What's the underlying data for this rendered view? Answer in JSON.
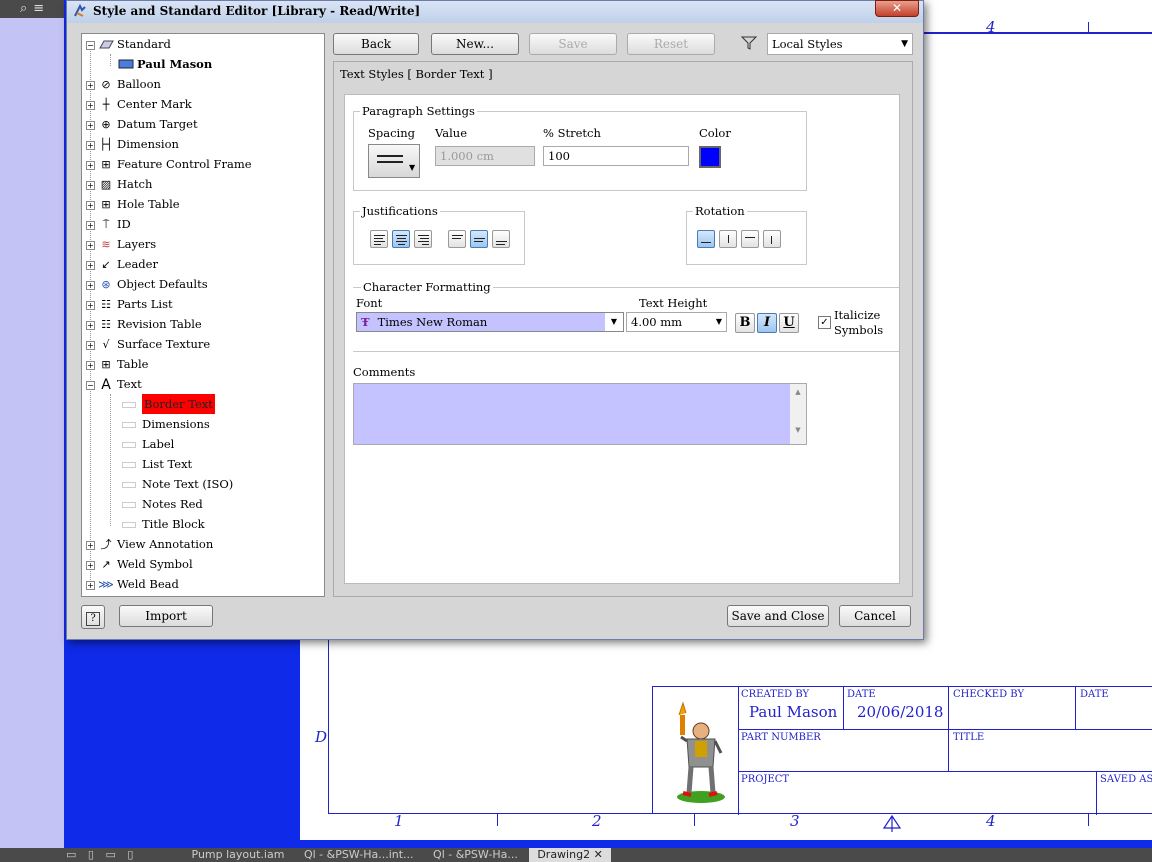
{
  "topbar": {
    "icons": [
      "search-icon",
      "menu-icon"
    ]
  },
  "drawing": {
    "top_number": "4",
    "zone_numbers": [
      "1",
      "2",
      "3",
      "4"
    ],
    "zone_letter": "D",
    "title_block": {
      "created_by_label": "CREATED BY",
      "created_by_value": "Paul Mason",
      "date_label": "DATE",
      "date_value": "20/06/2018",
      "checked_by_label": "CHECKED BY",
      "date2_label": "DATE",
      "part_number_label": "PART NUMBER",
      "title_label": "TITLE",
      "project_label": "PROJECT",
      "saved_as_label": "SAVED AS"
    }
  },
  "bottombar": {
    "tabs": [
      "Pump layout.iam",
      "Ql - &PSW-Ha...int...",
      "Ql - &PSW-Ha...",
      "Drawing2"
    ],
    "active_tab": "Drawing2",
    "close": "✕"
  },
  "dialog": {
    "title": "Style and Standard Editor [Library - Read/Write]",
    "close": "✕",
    "toolbar": {
      "back": "Back",
      "new": "New...",
      "save": "Save",
      "reset": "Reset",
      "filter_value": "Local Styles"
    },
    "tree": {
      "items": [
        {
          "label": "Standard",
          "icon": "standard-icon",
          "level": 0,
          "expanded": true
        },
        {
          "label": "Paul Mason",
          "icon": "style-icon",
          "level": 1,
          "bold": true
        },
        {
          "label": "Balloon",
          "icon": "balloon-icon",
          "level": 0
        },
        {
          "label": "Center Mark",
          "icon": "center-mark-icon",
          "level": 0
        },
        {
          "label": "Datum Target",
          "icon": "datum-target-icon",
          "level": 0
        },
        {
          "label": "Dimension",
          "icon": "dimension-icon",
          "level": 0
        },
        {
          "label": "Feature Control Frame",
          "icon": "feature-control-frame-icon",
          "level": 0
        },
        {
          "label": "Hatch",
          "icon": "hatch-icon",
          "level": 0
        },
        {
          "label": "Hole Table",
          "icon": "hole-table-icon",
          "level": 0
        },
        {
          "label": "ID",
          "icon": "id-icon",
          "level": 0
        },
        {
          "label": "Layers",
          "icon": "layers-icon",
          "level": 0
        },
        {
          "label": "Leader",
          "icon": "leader-icon",
          "level": 0
        },
        {
          "label": "Object Defaults",
          "icon": "object-defaults-icon",
          "level": 0
        },
        {
          "label": "Parts List",
          "icon": "parts-list-icon",
          "level": 0
        },
        {
          "label": "Revision Table",
          "icon": "revision-table-icon",
          "level": 0
        },
        {
          "label": "Surface Texture",
          "icon": "surface-texture-icon",
          "level": 0
        },
        {
          "label": "Table",
          "icon": "table-icon",
          "level": 0
        },
        {
          "label": "Text",
          "icon": "text-icon",
          "level": 0,
          "expanded": true
        },
        {
          "label": "Border Text",
          "icon": "text-style-icon",
          "level": 1,
          "selected": true
        },
        {
          "label": "Dimensions",
          "icon": "text-style-icon",
          "level": 1
        },
        {
          "label": "Label",
          "icon": "text-style-icon",
          "level": 1
        },
        {
          "label": "List Text",
          "icon": "text-style-icon",
          "level": 1
        },
        {
          "label": "Note Text (ISO)",
          "icon": "text-style-icon",
          "level": 1
        },
        {
          "label": "Notes Red",
          "icon": "text-style-icon",
          "level": 1
        },
        {
          "label": "Title Block",
          "icon": "text-style-icon",
          "level": 1
        },
        {
          "label": "View Annotation",
          "icon": "view-annotation-icon",
          "level": 0
        },
        {
          "label": "Weld Symbol",
          "icon": "weld-symbol-icon",
          "level": 0
        },
        {
          "label": "Weld Bead",
          "icon": "weld-bead-icon",
          "level": 0
        }
      ]
    },
    "panel_title": "Text Styles [ Border Text ]",
    "paragraph": {
      "legend": "Paragraph Settings",
      "spacing_label": "Spacing",
      "value_label": "Value",
      "value": "1.000 cm",
      "stretch_label": "% Stretch",
      "stretch": "100",
      "color_label": "Color",
      "color": "#0000ff"
    },
    "justifications": {
      "legend": "Justifications"
    },
    "rotation": {
      "legend": "Rotation"
    },
    "character": {
      "legend": "Character Formatting",
      "font_label": "Font",
      "font_value": "Times New Roman",
      "height_label": "Text Height",
      "height_value": "4.00 mm",
      "bold": "B",
      "italic": "I",
      "underline": "U",
      "italicize_label": "Italicize\nSymbols",
      "italicize_checked": true
    },
    "comments": {
      "label": "Comments",
      "value": ""
    },
    "footer": {
      "import": "Import",
      "save_close": "Save and Close",
      "cancel": "Cancel",
      "help": "?"
    }
  },
  "colors": {
    "accent": "#2222cc",
    "selection_red": "#ff0000",
    "input_lavender": "#c4c3ff",
    "background_blue": "#0f2ae8"
  }
}
